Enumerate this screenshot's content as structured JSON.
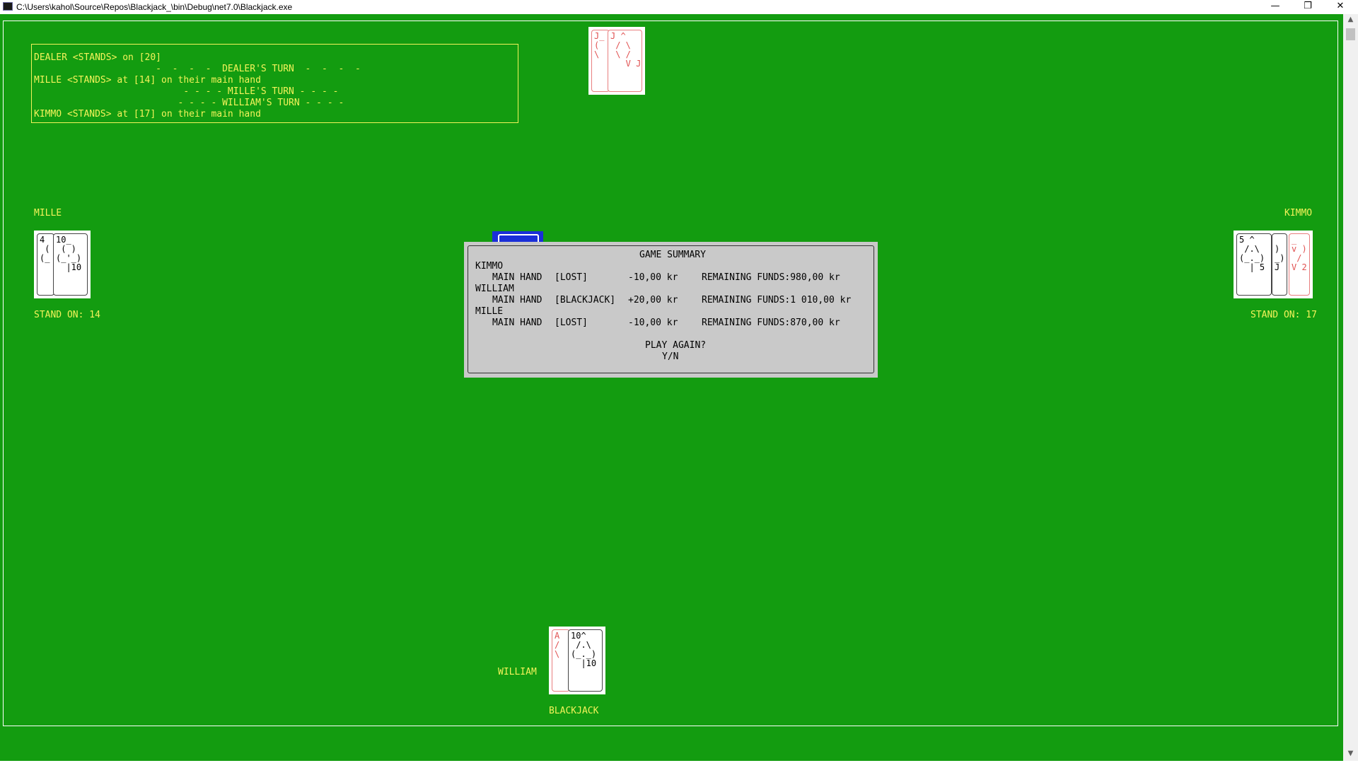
{
  "window": {
    "title": "C:\\Users\\kahol\\Source\\Repos\\Blackjack_\\bin\\Debug\\net7.0\\Blackjack.exe",
    "minimize": "—",
    "restore": "❐",
    "close": "✕"
  },
  "log": {
    "lines": [
      "DEALER <STANDS> on [20]",
      "                      -  -  -  -  DEALER'S TURN  -  -  -  -",
      "MILLE <STANDS> at [14] on their main hand",
      "                           - - - - MILLE'S TURN - - - -",
      "                          - - - - WILLIAM'S TURN - - - -",
      "KIMMO <STANDS> at [17] on their main hand"
    ]
  },
  "dealer": {
    "cards": [
      {
        "text": "J_\n(\n\\",
        "color": "red"
      },
      {
        "text": "J ^\n / \\\n \\ /\n   V J",
        "color": "red"
      }
    ]
  },
  "players": {
    "mille": {
      "name": "MILLE",
      "status": "STAND ON: 14",
      "cards": [
        {
          "text": "4\n (\n(_",
          "color": "black"
        },
        {
          "text": "10_\n ( )\n(_'_)\n  |10",
          "color": "black"
        }
      ]
    },
    "kimmo": {
      "name": "KIMMO",
      "status": "STAND ON: 17",
      "cards": [
        {
          "text": "5 ^\n /.\\\n(_._)\n  | 5",
          "color": "black"
        },
        {
          "text": "\n)\n_)\nJ",
          "color": "black"
        },
        {
          "text": "_\nv )\n /\nV 2",
          "color": "red"
        }
      ]
    },
    "william": {
      "name": "WILLIAM",
      "status": "BLACKJACK",
      "cards": [
        {
          "text": "A\n/\n\\",
          "color": "red"
        },
        {
          "text": "10^\n /.\\\n(_._)\n  |10",
          "color": "black"
        }
      ]
    }
  },
  "summary": {
    "title": "GAME SUMMARY",
    "rows": [
      {
        "player": "KIMMO",
        "hand": "MAIN HAND",
        "result": "[LOST]",
        "amount": "-10,00 kr",
        "funds": "REMAINING FUNDS:980,00 kr"
      },
      {
        "player": "WILLIAM",
        "hand": "MAIN HAND",
        "result": "[BLACKJACK]",
        "amount": "+20,00 kr",
        "funds": "REMAINING FUNDS:1 010,00 kr"
      },
      {
        "player": "MILLE",
        "hand": "MAIN HAND",
        "result": "[LOST]",
        "amount": "-10,00 kr",
        "funds": "REMAINING FUNDS:870,00 kr"
      }
    ],
    "prompt": "PLAY AGAIN?",
    "options": "Y/N"
  },
  "colors": {
    "table": "#139c10",
    "text": "#f3f35a",
    "deck": "#1a2fd8",
    "summary_bg": "#c9c9c9"
  }
}
